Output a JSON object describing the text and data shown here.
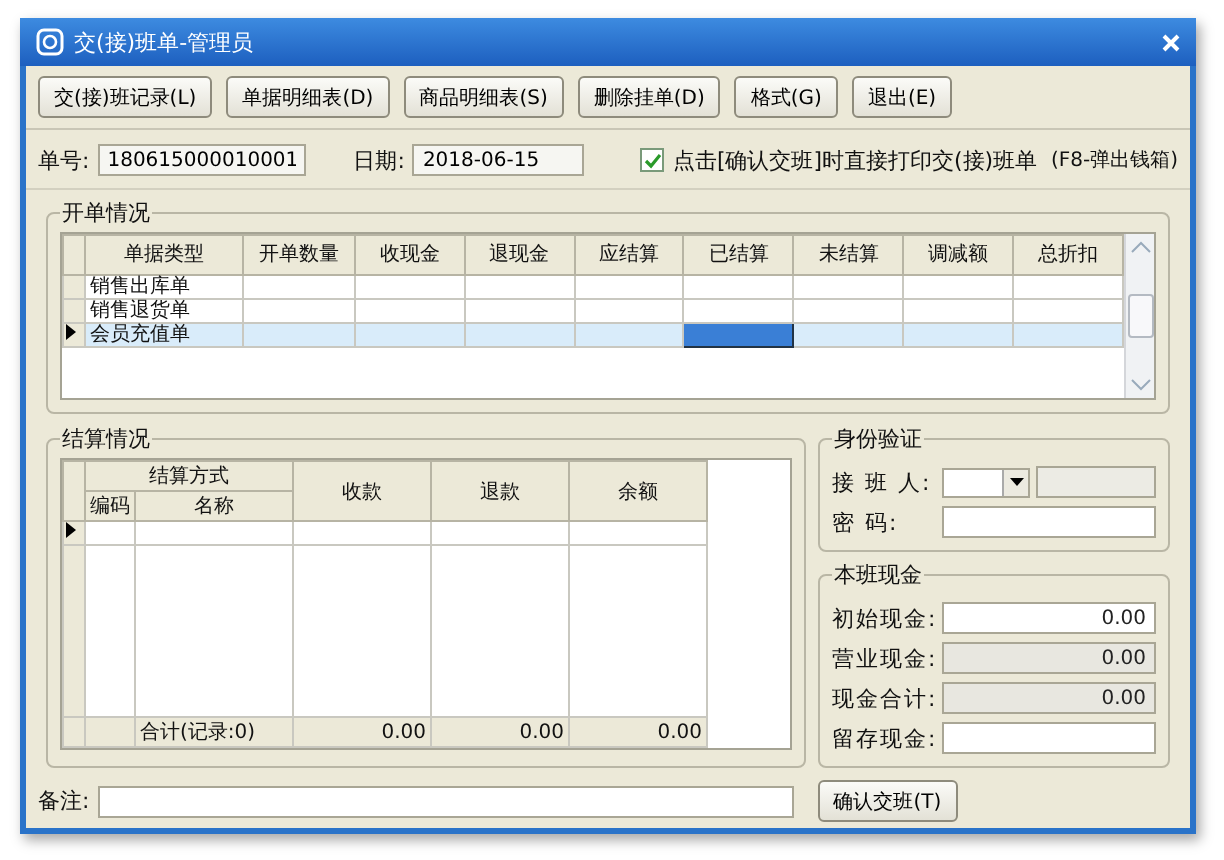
{
  "window": {
    "title": "交(接)班单-管理员"
  },
  "toolbar": [
    "交(接)班记录(L)",
    "单据明细表(D)",
    "商品明细表(S)",
    "删除挂单(D)",
    "格式(G)",
    "退出(E)"
  ],
  "order_no": {
    "label": "单号:",
    "value": "180615000010001"
  },
  "date": {
    "label": "日期:",
    "value": "2018-06-15"
  },
  "print_option": {
    "label": "点击[确认交班]时直接打印交(接)班单",
    "checked": true
  },
  "hint": "(F8-弹出钱箱)",
  "orders": {
    "title": "开单情况",
    "columns": [
      {
        "label": "单据类型",
        "focused": false
      },
      {
        "label": "开单数量",
        "focused": false
      },
      {
        "label": "收现金",
        "focused": false
      },
      {
        "label": "退现金",
        "focused": false
      },
      {
        "label": "应结算",
        "focused": false
      },
      {
        "label": "已结算",
        "focused": true
      },
      {
        "label": "未结算",
        "focused": false
      },
      {
        "label": "调减额",
        "focused": false
      },
      {
        "label": "总折扣",
        "focused": false
      }
    ],
    "rows": [
      {
        "type": "销售出库单",
        "selected": false
      },
      {
        "type": "销售退货单",
        "selected": false
      },
      {
        "type": "会员充值单",
        "selected": true
      }
    ]
  },
  "settlement": {
    "title": "结算情况",
    "method_header": "结算方式",
    "code_header": "编码",
    "name_header": "名称",
    "columns": [
      "收款",
      "退款",
      "余额"
    ],
    "total_label": "合计(记录:0)",
    "totals": [
      "0.00",
      "0.00",
      "0.00"
    ]
  },
  "identity": {
    "title": "身份验证",
    "receiver_label": "接 班 人:",
    "password_label": "密 码:"
  },
  "cash": {
    "title": "本班现金",
    "rows": [
      {
        "label": "初始现金:",
        "value": "0.00",
        "disabled": false
      },
      {
        "label": "营业现金:",
        "value": "0.00",
        "disabled": true
      },
      {
        "label": "现金合计:",
        "value": "0.00",
        "disabled": true
      },
      {
        "label": "留存现金:",
        "disabled": false
      }
    ]
  },
  "remark": {
    "label": "备注:"
  },
  "confirm_button": "确认交班(T)"
}
